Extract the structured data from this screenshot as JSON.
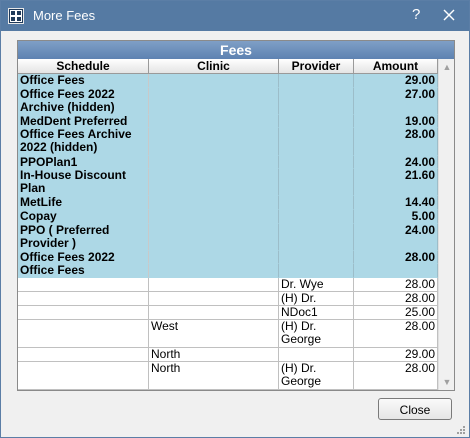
{
  "window": {
    "title": "More Fees",
    "help": "?"
  },
  "grid": {
    "title": "Fees",
    "columns": [
      "Schedule",
      "Clinic",
      "Provider",
      "Amount"
    ],
    "rows": [
      {
        "kind": "fee",
        "lines": 1,
        "schedule": "Office Fees",
        "clinic": "",
        "provider": "",
        "amount": "29.00"
      },
      {
        "kind": "fee",
        "lines": 2,
        "schedule": "Office Fees 2022 Archive (hidden)",
        "clinic": "",
        "provider": "",
        "amount": "27.00"
      },
      {
        "kind": "fee",
        "lines": 1,
        "schedule": "MedDent Preferred",
        "clinic": "",
        "provider": "",
        "amount": "19.00"
      },
      {
        "kind": "fee",
        "lines": 2,
        "schedule": "Office Fees Archive 2022 (hidden)",
        "clinic": "",
        "provider": "",
        "amount": "28.00"
      },
      {
        "kind": "fee",
        "lines": 1,
        "schedule": "PPOPlan1",
        "clinic": "",
        "provider": "",
        "amount": "24.00"
      },
      {
        "kind": "fee",
        "lines": 2,
        "schedule": "In-House Discount Plan",
        "clinic": "",
        "provider": "",
        "amount": "21.60"
      },
      {
        "kind": "fee",
        "lines": 1,
        "schedule": "MetLife",
        "clinic": "",
        "provider": "",
        "amount": "14.40"
      },
      {
        "kind": "fee",
        "lines": 1,
        "schedule": "Copay",
        "clinic": "",
        "provider": "",
        "amount": "5.00"
      },
      {
        "kind": "fee",
        "lines": 2,
        "schedule": "PPO ( Preferred Provider )",
        "clinic": "",
        "provider": "",
        "amount": "24.00"
      },
      {
        "kind": "fee",
        "lines": 1,
        "schedule": "Office Fees 2022",
        "clinic": "",
        "provider": "",
        "amount": "28.00"
      },
      {
        "kind": "fee",
        "lines": 1,
        "schedule": "Office Fees",
        "clinic": "",
        "provider": "",
        "amount": ""
      },
      {
        "kind": "detail",
        "lines": 1,
        "schedule": "",
        "clinic": "",
        "provider": "Dr. Wye",
        "amount": "28.00"
      },
      {
        "kind": "detail",
        "lines": 1,
        "schedule": "",
        "clinic": "",
        "provider": "(H) Dr. Jones",
        "amount": "28.00"
      },
      {
        "kind": "detail",
        "lines": 1,
        "schedule": "",
        "clinic": "",
        "provider": "NDoc1",
        "amount": "25.00"
      },
      {
        "kind": "detail",
        "lines": 2,
        "schedule": "",
        "clinic": "West",
        "provider": "(H) Dr. George",
        "amount": "28.00"
      },
      {
        "kind": "detail",
        "lines": 1,
        "schedule": "",
        "clinic": "North",
        "provider": "",
        "amount": "29.00"
      },
      {
        "kind": "detail",
        "lines": 2,
        "schedule": "",
        "clinic": "North",
        "provider": "(H) Dr. George",
        "amount": "28.00"
      }
    ]
  },
  "buttons": {
    "close": "Close"
  },
  "icons": {
    "app": "app-grid-icon",
    "close": "close-icon",
    "scroll_up": "scroll-up-arrow-icon",
    "scroll_down": "scroll-down-arrow-icon",
    "resize": "resize-grip-icon"
  },
  "colors": {
    "titlebar": "#557aa3",
    "fee_row": "#add8e6",
    "grid_title": "#5d82b1"
  }
}
